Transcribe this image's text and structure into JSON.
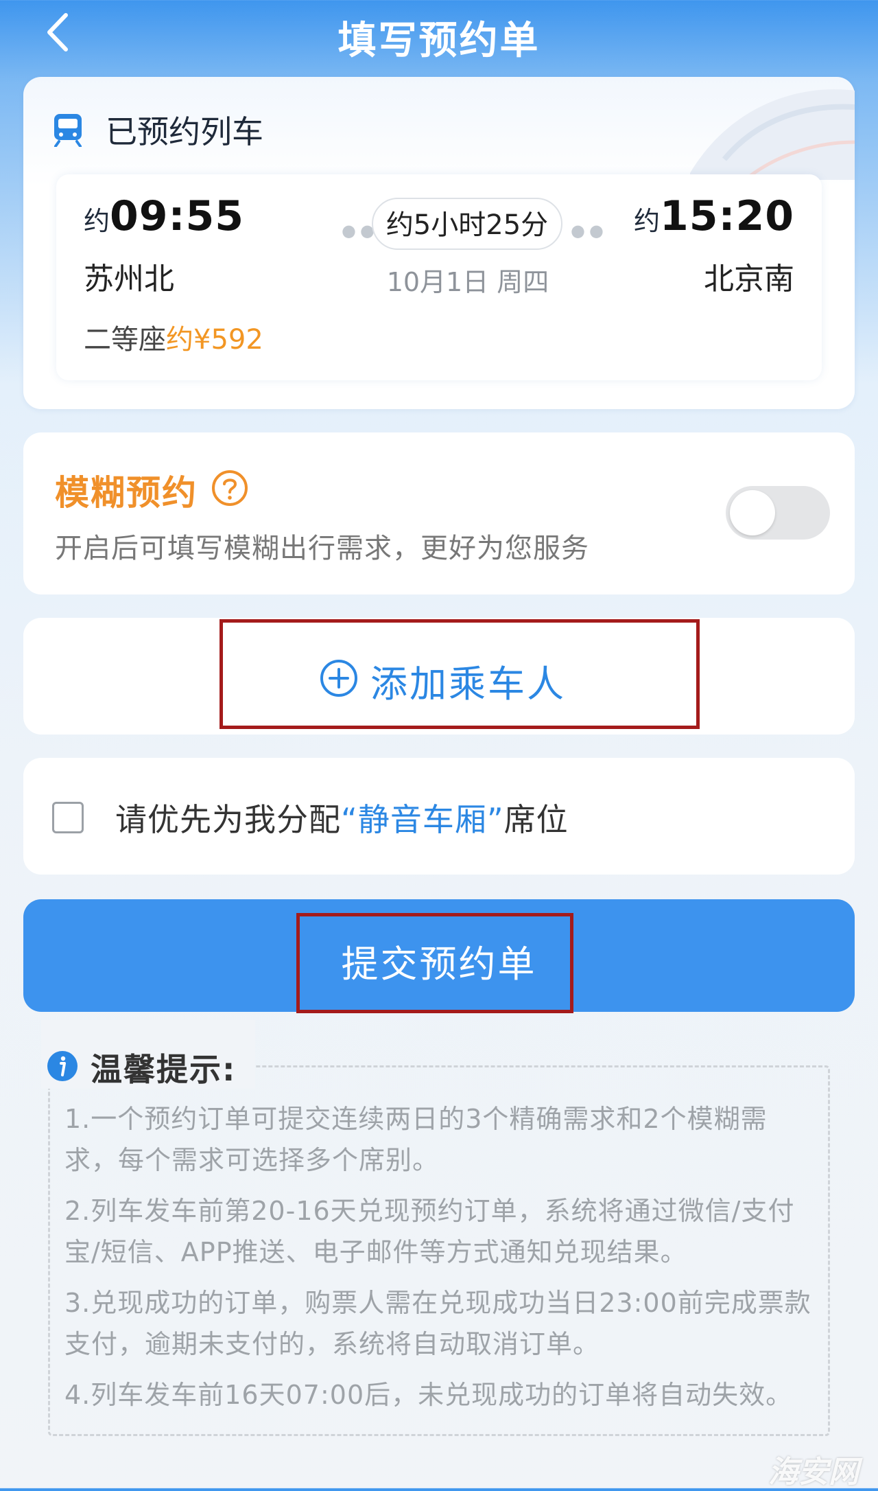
{
  "header": {
    "title": "填写预约单"
  },
  "train": {
    "section_title": "已预约列车",
    "departure": {
      "prefix": "约",
      "time": "09:55",
      "station": "苏州北"
    },
    "arrival": {
      "prefix": "约",
      "time": "15:20",
      "station": "北京南"
    },
    "duration": "约5小时25分",
    "date": "10月1日 周四",
    "seat_class": "二等座",
    "price": "约¥592"
  },
  "fuzzy": {
    "title": "模糊预约",
    "description": "开启后可填写模糊出行需求，更好为您服务",
    "enabled": false
  },
  "passenger": {
    "add_label": "添加乘车人"
  },
  "quiet_car": {
    "prefix": "请优先为我分配",
    "highlight": "“静音车厢”",
    "suffix": "席位",
    "checked": false
  },
  "submit": {
    "label": "提交预约单"
  },
  "tips": {
    "title": "温馨提示:",
    "items": [
      "1.一个预约订单可提交连续两日的3个精确需求和2个模糊需求，每个需求可选择多个席别。",
      "2.列车发车前第20-16天兑现预约订单，系统将通过微信/支付宝/短信、APP推送、电子邮件等方式通知兑现结果。",
      "3.兑现成功的订单，购票人需在兑现成功当日23:00前完成票款支付，逾期未支付的，系统将自动取消订单。",
      "4.列车发车前16天07:00后，未兑现成功的订单将自动失效。"
    ]
  },
  "watermark": "海安网",
  "colors": {
    "primary": "#3d93ee",
    "accent_orange": "#f0902a",
    "highlight_box": "#a41b1b"
  }
}
